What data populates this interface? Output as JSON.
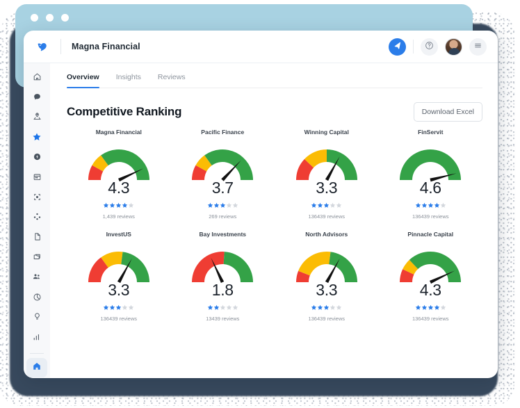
{
  "window": {
    "dots_count": 3,
    "chrome_color": "#a8d2e2",
    "frame_shadow_color": "#394a5e"
  },
  "header": {
    "logo_icon": "bird-logo-icon",
    "title": "Magna Financial",
    "actions": [
      {
        "icon": "send-icon",
        "name": "send-button",
        "variant": "primary"
      },
      {
        "icon": "help-circle-icon",
        "name": "help-button",
        "variant": "plain"
      },
      {
        "icon": "avatar",
        "name": "user-avatar",
        "variant": "avatar"
      },
      {
        "icon": "menu-icon",
        "name": "menu-button",
        "variant": "plain"
      }
    ]
  },
  "sidebar": {
    "items": [
      {
        "icon": "home-outline-icon",
        "name": "sidebar-item-home",
        "state": "default"
      },
      {
        "icon": "chat-bubble-icon",
        "name": "sidebar-item-messages",
        "state": "default"
      },
      {
        "icon": "map-pin-icon",
        "name": "sidebar-item-locations",
        "state": "default"
      },
      {
        "icon": "star-icon",
        "name": "sidebar-item-reviews",
        "state": "active"
      },
      {
        "icon": "coin-icon",
        "name": "sidebar-item-payments",
        "state": "default"
      },
      {
        "icon": "calendar-icon",
        "name": "sidebar-item-calendar",
        "state": "default"
      },
      {
        "icon": "qr-code-icon",
        "name": "sidebar-item-qr",
        "state": "default"
      },
      {
        "icon": "share-nodes-icon",
        "name": "sidebar-item-share",
        "state": "default"
      },
      {
        "icon": "document-icon",
        "name": "sidebar-item-documents",
        "state": "default"
      },
      {
        "icon": "folder-icon",
        "name": "sidebar-item-files",
        "state": "default"
      },
      {
        "icon": "users-icon",
        "name": "sidebar-item-team",
        "state": "default"
      },
      {
        "icon": "pie-chart-icon",
        "name": "sidebar-item-reports",
        "state": "default"
      },
      {
        "icon": "lightbulb-icon",
        "name": "sidebar-item-insights",
        "state": "default"
      },
      {
        "icon": "bar-chart-icon",
        "name": "sidebar-item-analytics",
        "state": "default"
      }
    ],
    "footer_item": {
      "icon": "home-filled-icon",
      "name": "sidebar-item-dashboard",
      "state": "active"
    }
  },
  "main": {
    "tabs": [
      {
        "label": "Overview",
        "active": true
      },
      {
        "label": "Insights",
        "active": false
      },
      {
        "label": "Reviews",
        "active": false
      }
    ],
    "page_title": "Competitive Ranking",
    "download_button": "Download Excel"
  },
  "colors": {
    "accent": "#2b7de9",
    "star_filled": "#2b7de9",
    "star_empty": "#d3d7dd",
    "gauge_red": "#ef3d33",
    "gauge_orange": "#fbbc04",
    "gauge_green": "#34a247",
    "title_text": "#111820"
  },
  "chart_data": {
    "type": "gauge",
    "title": "Competitive Ranking",
    "scale": {
      "min": 0,
      "max": 5
    },
    "sweep_degrees": 180,
    "band_colors": [
      "#ef3d33",
      "#fbbc04",
      "#34a247"
    ],
    "items": [
      {
        "name": "Magna Financial",
        "value": 4.3,
        "stars_filled": 4,
        "stars_total": 5,
        "reviews_label": "1,439 reviews",
        "reviews_count": 1439,
        "bands": [
          {
            "color": "#ef3d33",
            "from": 0.0,
            "to": 0.8
          },
          {
            "color": "#fbbc04",
            "from": 0.8,
            "to": 1.5
          },
          {
            "color": "#34a247",
            "from": 1.5,
            "to": 5.0
          }
        ]
      },
      {
        "name": "Pacific Finance",
        "value": 3.7,
        "stars_filled": 3,
        "stars_total": 5,
        "reviews_label": "269 reviews",
        "reviews_count": 269,
        "bands": [
          {
            "color": "#ef3d33",
            "from": 0.0,
            "to": 0.8
          },
          {
            "color": "#fbbc04",
            "from": 0.8,
            "to": 1.5
          },
          {
            "color": "#34a247",
            "from": 1.5,
            "to": 5.0
          }
        ]
      },
      {
        "name": "Winning Capital",
        "value": 3.3,
        "stars_filled": 3,
        "stars_total": 5,
        "reviews_label": "136439 reviews",
        "reviews_count": 136439,
        "bands": [
          {
            "color": "#ef3d33",
            "from": 0.0,
            "to": 1.2
          },
          {
            "color": "#fbbc04",
            "from": 1.2,
            "to": 2.5
          },
          {
            "color": "#34a247",
            "from": 2.5,
            "to": 5.0
          }
        ]
      },
      {
        "name": "FinServit",
        "value": 4.6,
        "stars_filled": 4,
        "stars_total": 5,
        "reviews_label": "136439 reviews",
        "reviews_count": 136439,
        "bands": [
          {
            "color": "#34a247",
            "from": 0.0,
            "to": 5.0
          }
        ]
      },
      {
        "name": "InvestUS",
        "value": 3.3,
        "stars_filled": 3,
        "stars_total": 5,
        "reviews_label": "136439 reviews",
        "reviews_count": 136439,
        "bands": [
          {
            "color": "#ef3d33",
            "from": 0.0,
            "to": 1.5
          },
          {
            "color": "#fbbc04",
            "from": 1.5,
            "to": 2.7
          },
          {
            "color": "#34a247",
            "from": 2.7,
            "to": 5.0
          }
        ]
      },
      {
        "name": "Bay Investments",
        "value": 1.8,
        "stars_filled": 2,
        "stars_total": 5,
        "reviews_label": "13439 reviews",
        "reviews_count": 13439,
        "bands": [
          {
            "color": "#ef3d33",
            "from": 0.0,
            "to": 2.6
          },
          {
            "color": "#34a247",
            "from": 2.6,
            "to": 5.0
          }
        ]
      },
      {
        "name": "North Advisors",
        "value": 3.3,
        "stars_filled": 3,
        "stars_total": 5,
        "reviews_label": "136439 reviews",
        "reviews_count": 136439,
        "bands": [
          {
            "color": "#ef3d33",
            "from": 0.0,
            "to": 0.6
          },
          {
            "color": "#fbbc04",
            "from": 0.6,
            "to": 2.7
          },
          {
            "color": "#34a247",
            "from": 2.7,
            "to": 5.0
          }
        ]
      },
      {
        "name": "Pinnacle Capital",
        "value": 4.3,
        "stars_filled": 4,
        "stars_total": 5,
        "reviews_label": "136439 reviews",
        "reviews_count": 136439,
        "bands": [
          {
            "color": "#ef3d33",
            "from": 0.0,
            "to": 0.7
          },
          {
            "color": "#fbbc04",
            "from": 0.7,
            "to": 1.3
          },
          {
            "color": "#34a247",
            "from": 1.3,
            "to": 5.0
          }
        ]
      }
    ]
  }
}
